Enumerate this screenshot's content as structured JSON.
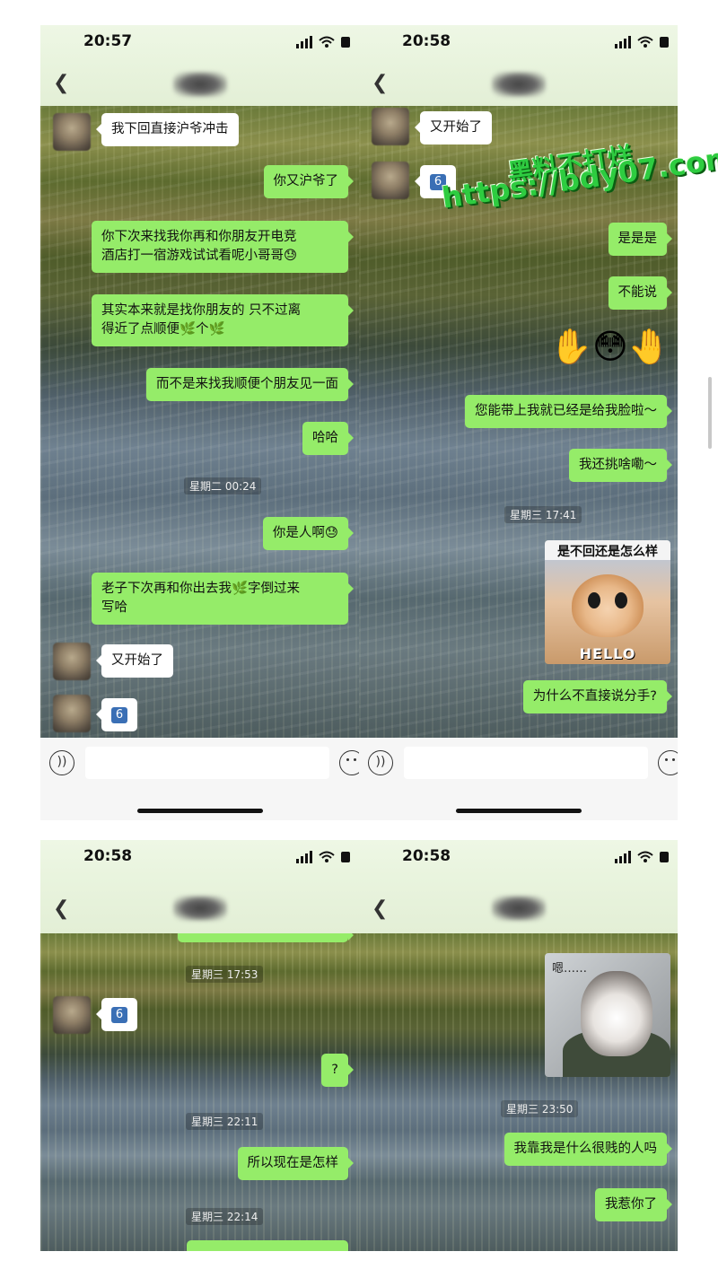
{
  "panels": [
    {
      "time": "20:57",
      "messages": [
        {
          "side": "in",
          "text": "我下回直接沪爷冲击"
        },
        {
          "side": "out",
          "text": "你又沪爷了"
        },
        {
          "side": "out",
          "text": "你下次来找我你再和你朋友开电竞\n酒店打一宿游戏试试看呢小哥哥😓"
        },
        {
          "side": "out",
          "text": "其实本来就是找你朋友的 只不过离\n得近了点顺便🌿个🌿"
        },
        {
          "side": "out",
          "text": "而不是来找我顺便个朋友见一面"
        },
        {
          "side": "out",
          "text": "哈哈"
        },
        {
          "side": "out",
          "text": "你是人啊😓"
        },
        {
          "side": "out",
          "text": "老子下次再和你出去我🌿字倒过来\n写哈"
        },
        {
          "side": "in",
          "text": "又开始了"
        },
        {
          "side": "in",
          "text": "6"
        }
      ],
      "timestamps": [
        "星期二 00:24"
      ]
    },
    {
      "time": "20:58",
      "messages": [
        {
          "side": "in",
          "text": "又开始了"
        },
        {
          "side": "in",
          "text": "6"
        },
        {
          "side": "out",
          "text": "是是是"
        },
        {
          "side": "out",
          "text": "不能说"
        },
        {
          "side": "out",
          "text": "您能带上我就已经是给我脸啦～"
        },
        {
          "side": "out",
          "text": "我还挑啥嘞～"
        },
        {
          "side": "out",
          "text": "为什么不直接说分手?"
        }
      ],
      "timestamps": [
        "星期三 17:41"
      ],
      "emojis": "✋😳🤚",
      "sticker_caption": "是不回还是怎么样",
      "sticker_text": "HELLO"
    },
    {
      "time": "20:58",
      "messages": [
        {
          "side": "in",
          "text": "6"
        },
        {
          "side": "out",
          "text": "?"
        },
        {
          "side": "out",
          "text": "所以现在是怎样"
        }
      ],
      "timestamps": [
        "星期三 17:53",
        "星期三 22:11",
        "星期三 22:14"
      ]
    },
    {
      "time": "20:58",
      "messages": [
        {
          "side": "out",
          "text": "我靠我是什么很贱的人吗"
        },
        {
          "side": "out",
          "text": "我惹你了"
        }
      ],
      "timestamps": [
        "星期三 23:50"
      ],
      "sticker_caption": "嗯……"
    }
  ],
  "watermark": {
    "line1": "黑料不打烊",
    "line2": "https://bdy07.com"
  },
  "icons": {
    "back": "chevron-left-icon",
    "voice": "voice-icon",
    "emoji": "emoji-icon",
    "signal": "signal-icon",
    "wifi": "wifi-icon",
    "battery": "battery-icon"
  },
  "colors": {
    "out_bubble": "#95ec69",
    "in_bubble": "#ffffff",
    "watermark": "#2ecc40"
  }
}
